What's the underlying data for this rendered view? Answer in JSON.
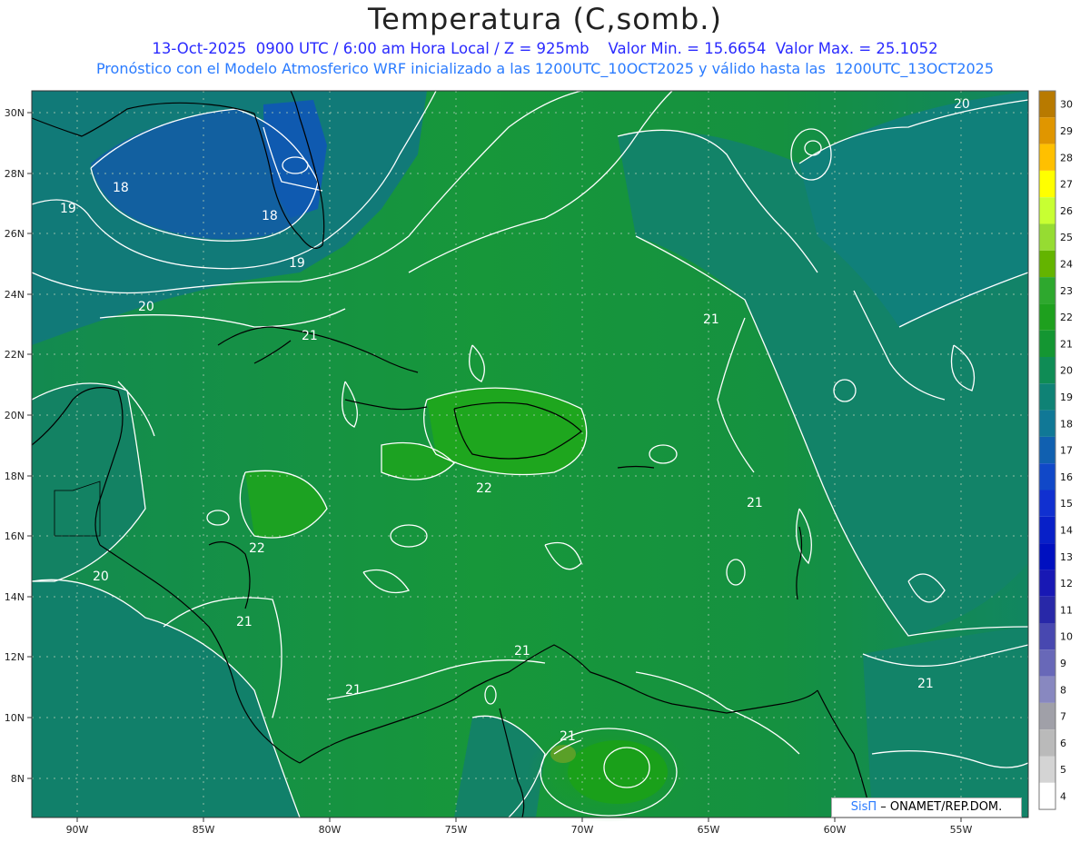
{
  "title": "Temperatura (C,somb.)",
  "subtitle_line1": "13-Oct-2025  0900 UTC / 6:00 am Hora Local / Z = 925mb    Valor Min. = 15.6654  Valor Max. = 25.1052",
  "subtitle_line2": "Pronóstico con el Modelo Atmosferico WRF inicializado a las 1200UTC_10OCT2025 y válido hasta las  1200UTC_13OCT2025",
  "credit": {
    "brand": "SisΠ",
    "text": "– ONAMET/REP.DOM."
  },
  "lat_labels": [
    "30N",
    "28N",
    "26N",
    "24N",
    "22N",
    "20N",
    "18N",
    "16N",
    "14N",
    "12N",
    "10N",
    "8N"
  ],
  "lon_labels": [
    "90W",
    "85W",
    "80W",
    "75W",
    "70W",
    "65W",
    "60W",
    "55W"
  ],
  "colorbar": {
    "labels": [
      "30",
      "29",
      "28",
      "27",
      "26",
      "25",
      "24",
      "23",
      "22",
      "21",
      "20",
      "19",
      "18",
      "17",
      "16",
      "15",
      "14",
      "13",
      "12",
      "11",
      "10",
      "9",
      "8",
      "7",
      "6",
      "5",
      "4"
    ],
    "colors": [
      "#b87a00",
      "#e09600",
      "#ffc000",
      "#ffff00",
      "#c8ff32",
      "#96dc32",
      "#64b400",
      "#2ea82e",
      "#1ea01e",
      "#149632",
      "#0f8c55",
      "#0f8275",
      "#107896",
      "#1060b0",
      "#1048c8",
      "#1030d0",
      "#0820c8",
      "#0010c0",
      "#1818b4",
      "#2828a8",
      "#4848b0",
      "#6868b8",
      "#8888c0",
      "#a0a0a8",
      "#bababa",
      "#d4d4d4",
      "#ffffff"
    ]
  },
  "contour_labels": [
    "20",
    "18",
    "19",
    "18",
    "19",
    "20",
    "21",
    "21",
    "22",
    "22",
    "20",
    "21",
    "21",
    "21",
    "21",
    "21",
    "21"
  ]
}
